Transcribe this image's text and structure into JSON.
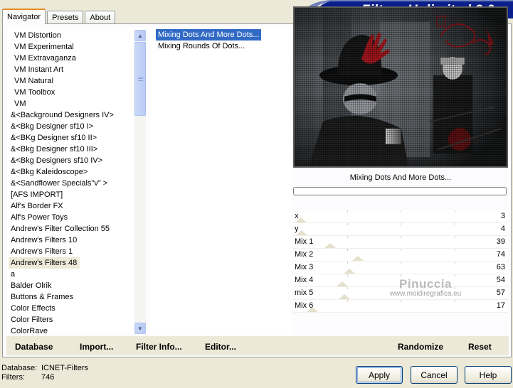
{
  "app": {
    "title": "Filters Unlimited 2.0",
    "tabs": [
      {
        "label": "Navigator",
        "active": true
      },
      {
        "label": "Presets",
        "active": false
      },
      {
        "label": "About",
        "active": false
      }
    ]
  },
  "categories": [
    "VM Distortion",
    "VM Experimental",
    "VM Extravaganza",
    "VM Instant Art",
    "VM Natural",
    "VM Toolbox",
    "VM",
    "&<Background Designers IV>",
    "&<Bkg Designer sf10 I>",
    "&<BKg Designer sf10 II>",
    "&<Bkg Designer sf10 III>",
    "&<Bkg Designers sf10 IV>",
    "&<Bkg Kaleidoscope>",
    "&<Sandflower Specials\"v\" >",
    "[AFS IMPORT]",
    "Alf's Border FX",
    "Alf's Power Toys",
    "Andrew's Filter Collection 55",
    "Andrew's Filters 10",
    "Andrew's Filters 1",
    "Andrew's Filters 48",
    "a",
    "Balder Olrik",
    "Buttons & Frames",
    "Color Effects",
    "Color Filters",
    "ColorRave"
  ],
  "selected_category": "Andrew's Filters 48",
  "filters": [
    {
      "label": "Mixing Dots And More Dots...",
      "selected": true
    },
    {
      "label": "Mixing Rounds Of Dots...",
      "selected": false
    }
  ],
  "preview": {
    "filter_name": "Mixing Dots And More Dots...",
    "progress": 0
  },
  "sliders": [
    {
      "label": "x",
      "value": 3,
      "max": 255
    },
    {
      "label": "y",
      "value": 4,
      "max": 255
    },
    {
      "label": "Mix 1",
      "value": 39,
      "max": 255
    },
    {
      "label": "Mix 2",
      "value": 74,
      "max": 255
    },
    {
      "label": "Mix 3",
      "value": 63,
      "max": 255
    },
    {
      "label": "Mix 4",
      "value": 54,
      "max": 255
    },
    {
      "label": "mix 5",
      "value": 57,
      "max": 255
    },
    {
      "label": "Mix 6",
      "value": 17,
      "max": 255
    }
  ],
  "watermark": {
    "name": "Pinuccia",
    "url": "www.moidiregrafica.eu"
  },
  "bottom_links": {
    "database": "Database",
    "import": "Import...",
    "filter_info": "Filter Info...",
    "editor": "Editor...",
    "randomize": "Randomize",
    "reset": "Reset"
  },
  "status": {
    "database_label": "Database:",
    "database_value": "ICNET-Filters",
    "filters_label": "Filters:",
    "filters_value": "746"
  },
  "buttons": {
    "apply": "Apply",
    "cancel": "Cancel",
    "help": "Help"
  },
  "colors": {
    "banner": "#0a1e8c",
    "selection": "#316ac5",
    "tab_highlight": "#e68b2c"
  }
}
